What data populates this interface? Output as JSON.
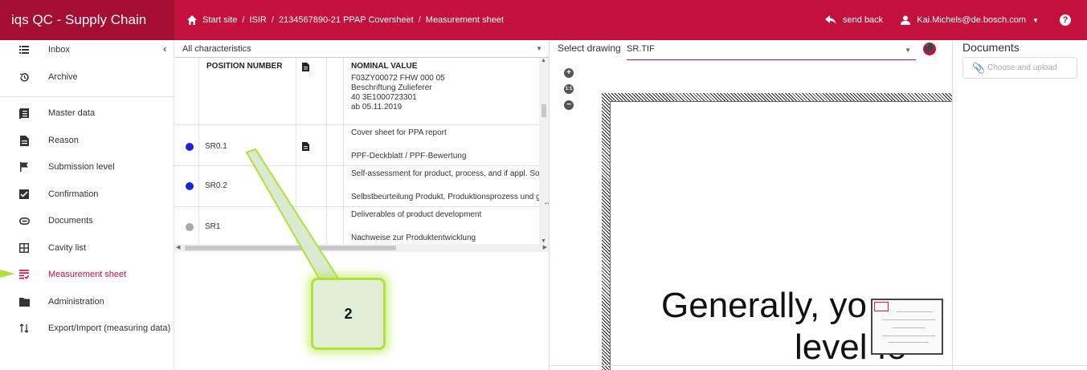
{
  "app": {
    "title": "iqs QC - Supply Chain"
  },
  "breadcrumb": {
    "items": [
      "Start site",
      "ISIR",
      "2134567890-21 PPAP Coversheet",
      "Measurement sheet"
    ],
    "sep": "/"
  },
  "header": {
    "send_back": "send back",
    "user": "Kai.Michels@de.bosch.com",
    "help": "?"
  },
  "sidebar": {
    "items": [
      {
        "label": "Inbox",
        "icon": "list-icon"
      },
      {
        "label": "Archive",
        "icon": "history-icon"
      },
      {
        "label": "Master data",
        "icon": "book-icon"
      },
      {
        "label": "Reason",
        "icon": "document-icon"
      },
      {
        "label": "Submission level",
        "icon": "flag-icon"
      },
      {
        "label": "Confirmation",
        "icon": "check-box-icon"
      },
      {
        "label": "Documents",
        "icon": "link-icon"
      },
      {
        "label": "Cavity list",
        "icon": "grid-icon"
      },
      {
        "label": "Measurement sheet",
        "icon": "checklist-icon",
        "active": true
      },
      {
        "label": "Administration",
        "icon": "folder-icon"
      },
      {
        "label": "Export/Import (measuring data)",
        "icon": "swap-icon"
      }
    ]
  },
  "filter": {
    "value": "All characteristics"
  },
  "table": {
    "headers": {
      "position": "POSITION NUMBER",
      "nominal": "NOMINAL VALUE"
    },
    "header_nominal_lines": [
      "F03ZY00072 FHW 000 05",
      "Beschriftung Zulieferer",
      "40 3E1000723301",
      "ab 05.11.2019"
    ],
    "rows": [
      {
        "pos": "SR0.1",
        "status_color": "#1a24d6",
        "has_doc": true,
        "line1": "Cover sheet for PPA report",
        "line2": "PPF-Deckblatt / PPF-Bewertung"
      },
      {
        "pos": "SR0.2",
        "status_color": "#1a24d6",
        "has_doc": false,
        "line1": "Self-assessment for product, process, and if appl. Sof",
        "line2": "Selbstbeurteilung Produkt, Produktionsprozess und g"
      },
      {
        "pos": "SR1",
        "status_color": "#a8a8a8",
        "has_doc": false,
        "line1": "Deliverables of product development",
        "line2": "Nachweise zur Produktentwicklung"
      }
    ]
  },
  "callout": {
    "number": "2"
  },
  "viewer": {
    "select_label": "Select drawing",
    "selected": "SR.TIF",
    "big_text_1": "Generally, yo",
    "big_text_2": "level fo"
  },
  "documents": {
    "title": "Documents",
    "upload_placeholder": "Choose and upload"
  },
  "colors": {
    "brand": "#c4103d",
    "brand_dark": "#a50d32",
    "status_blue": "#1a24d6",
    "status_grey": "#a8a8a8",
    "callout_green": "#b2e03a"
  }
}
